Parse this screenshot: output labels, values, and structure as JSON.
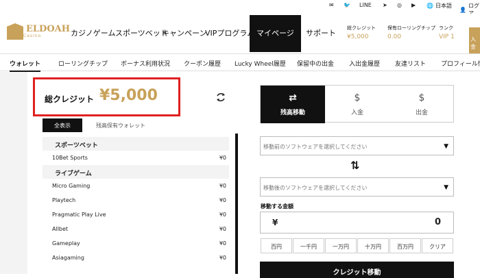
{
  "topbar": {
    "line": "LINE",
    "language": "日本語",
    "login": "ログア"
  },
  "brand": {
    "name": "ELDOAH",
    "sub": "Casino"
  },
  "nav": {
    "items": [
      "カジノゲーム",
      "スポーツベット",
      "キャンペーン",
      "VIPプログラム",
      "マイページ",
      "サポート"
    ],
    "active": "マイページ"
  },
  "stats": {
    "credit_label": "総クレジット",
    "credit_value": "¥5,000",
    "chip_label": "保有ローリングチップ",
    "chip_value": "0.00",
    "rank_label": "ランク",
    "rank_value": "VIP 1"
  },
  "login_btn": "入金",
  "subnav": [
    "ウォレット",
    "ローリングチップ",
    "ボーナス利用状況",
    "クーポン履歴",
    "Lucky Wheel履歴",
    "保留中の出金",
    "入出金履歴",
    "友達リスト",
    "プロフィール情"
  ],
  "wallet": {
    "total_label": "総クレジット",
    "total_value": "¥5,000",
    "tab_all": "全表示",
    "tab_held": "残高保有ウォレット"
  },
  "list": {
    "sports_cat": "スポーツベット",
    "sports_rows": [
      {
        "name": "10Bet Sports",
        "amt": "¥0"
      }
    ],
    "live_cat": "ライブゲーム",
    "live_rows": [
      {
        "name": "Micro Gaming",
        "amt": "¥0"
      },
      {
        "name": "Playtech",
        "amt": "¥0"
      },
      {
        "name": "Pragmatic Play Live",
        "amt": "¥0"
      },
      {
        "name": "Allbet",
        "amt": "¥0"
      },
      {
        "name": "Gameplay",
        "amt": "¥0"
      },
      {
        "name": "Asiagaming",
        "amt": "¥0"
      }
    ]
  },
  "transfer": {
    "tab_transfer": "残高移動",
    "tab_deposit": "入金",
    "tab_withdraw": "出金",
    "from_placeholder": "移動前のソフトウェアを選択してください",
    "to_placeholder": "移動後のソフトウェアを選択してください",
    "amount_label": "移動する金額",
    "currency": "¥",
    "amount": "0",
    "quick": [
      "百円",
      "一千円",
      "一万円",
      "十万円",
      "百万円",
      "クリア"
    ],
    "submit": "クレジット移動"
  }
}
